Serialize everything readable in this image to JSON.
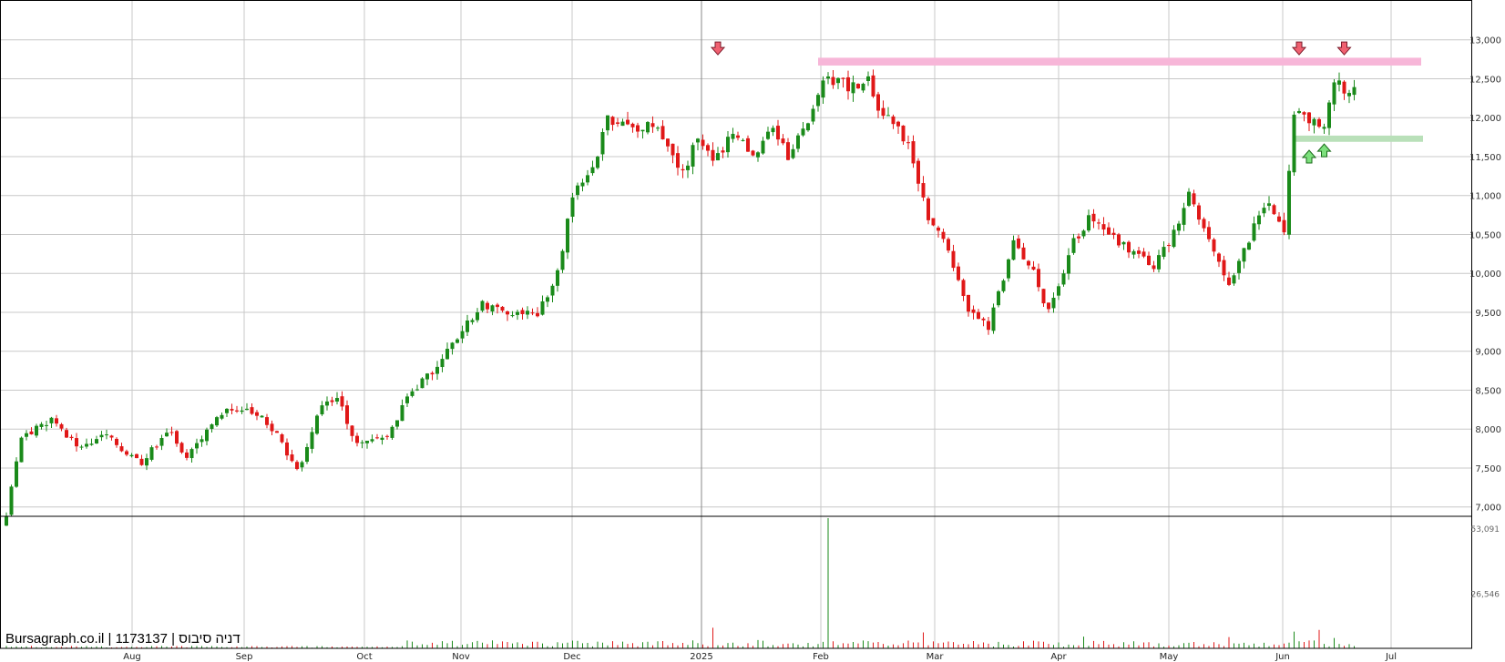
{
  "watermark": "Bursagraph.co.il | 1173137 | דניה סיבוס",
  "colors": {
    "up": "#1a8a1a",
    "down": "#e01818",
    "resistance": "#f7b6d8",
    "support": "#b9e0b9",
    "grid": "#c8c8c8",
    "arrow_down": "#f06070",
    "arrow_up": "#7de07d"
  },
  "chart_data": [
    {
      "type": "candlestick",
      "x_axis_labels": [
        "Aug",
        "Sep",
        "Oct",
        "Nov",
        "Dec",
        "2025",
        "Feb",
        "Mar",
        "Apr",
        "May",
        "Jun",
        "Jul"
      ],
      "y_ticks": [
        "7,000",
        "7,500",
        "8,000",
        "8,500",
        "9,000",
        "9,500",
        "10,000",
        "10,500",
        "11,000",
        "11,500",
        "12,000",
        "12,500",
        "13,000"
      ],
      "ylim": [
        6880,
        13500
      ],
      "grid": true,
      "resistance_zone": [
        12670,
        12770
      ],
      "support_zone": [
        11690,
        11770
      ],
      "signals_down": [
        {
          "idx": 142,
          "price": 12890
        },
        {
          "idx": 258,
          "price": 12890
        },
        {
          "idx": 267,
          "price": 12890
        }
      ],
      "signals_up": [
        {
          "idx": 260,
          "price": 11500
        },
        {
          "idx": 263,
          "price": 11580
        }
      ],
      "anchors": [
        [
          0,
          6900
        ],
        [
          3,
          7900
        ],
        [
          9,
          8100
        ],
        [
          14,
          7800
        ],
        [
          20,
          7900
        ],
        [
          27,
          7550
        ],
        [
          32,
          8000
        ],
        [
          36,
          7650
        ],
        [
          43,
          8200
        ],
        [
          48,
          8300
        ],
        [
          54,
          7950
        ],
        [
          58,
          7450
        ],
        [
          63,
          8300
        ],
        [
          66,
          8400
        ],
        [
          70,
          7800
        ],
        [
          76,
          7900
        ],
        [
          80,
          8400
        ],
        [
          86,
          8800
        ],
        [
          90,
          9200
        ],
        [
          95,
          9600
        ],
        [
          101,
          9450
        ],
        [
          106,
          9500
        ],
        [
          110,
          10000
        ],
        [
          113,
          11000
        ],
        [
          117,
          11300
        ],
        [
          120,
          12000
        ],
        [
          126,
          11800
        ],
        [
          129,
          11950
        ],
        [
          135,
          11300
        ],
        [
          138,
          11750
        ],
        [
          141,
          11400
        ],
        [
          145,
          11800
        ],
        [
          149,
          11500
        ],
        [
          153,
          11900
        ],
        [
          156,
          11500
        ],
        [
          160,
          12000
        ],
        [
          163,
          12550
        ],
        [
          168,
          12400
        ],
        [
          172,
          12500
        ],
        [
          174,
          12100
        ],
        [
          180,
          11700
        ],
        [
          184,
          10700
        ],
        [
          188,
          10300
        ],
        [
          192,
          9550
        ],
        [
          196,
          9300
        ],
        [
          201,
          10400
        ],
        [
          205,
          10000
        ],
        [
          208,
          9500
        ],
        [
          213,
          10400
        ],
        [
          216,
          10700
        ],
        [
          222,
          10400
        ],
        [
          226,
          10200
        ],
        [
          229,
          10100
        ],
        [
          233,
          10500
        ],
        [
          236,
          11000
        ],
        [
          240,
          10400
        ],
        [
          244,
          9800
        ],
        [
          249,
          10600
        ],
        [
          252,
          10900
        ],
        [
          255,
          10500
        ],
        [
          257,
          12100
        ],
        [
          260,
          12000
        ],
        [
          263,
          11900
        ],
        [
          265,
          12450
        ],
        [
          268,
          12350
        ],
        [
          269,
          12450
        ]
      ]
    },
    {
      "type": "bar",
      "name": "volume",
      "y_ticks": [
        "53,091",
        "26,546"
      ],
      "ylim": [
        0,
        53091
      ]
    }
  ]
}
